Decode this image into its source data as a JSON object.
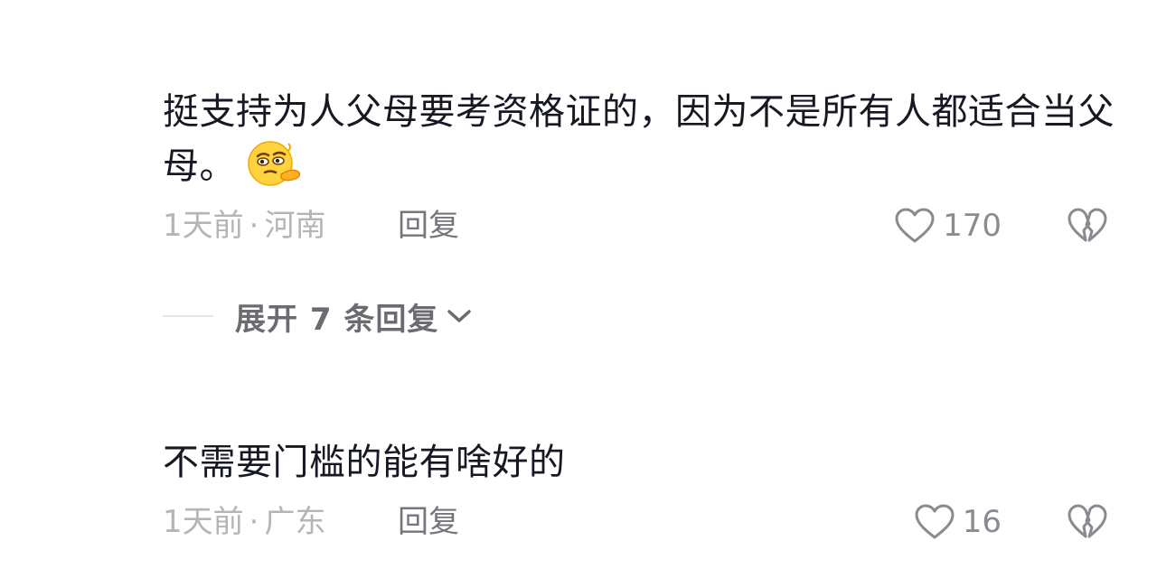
{
  "comments": [
    {
      "text": "挺支持为人父母要考资格证的，因为不是所有人都适合当父母。",
      "emoji": "thinking-face-emoji",
      "time": "1天前",
      "location": "河南",
      "reply_label": "回复",
      "likes": "170"
    },
    {
      "text": "不需要门槛的能有啥好的",
      "time": "1天前",
      "location": "广东",
      "reply_label": "回复",
      "likes": "16"
    }
  ],
  "expand_replies": {
    "label": "展开 7 条回复"
  },
  "colors": {
    "text": "#161823",
    "meta": "#b4b5b9",
    "reply": "#75767d",
    "icon": "#8a8b91"
  }
}
